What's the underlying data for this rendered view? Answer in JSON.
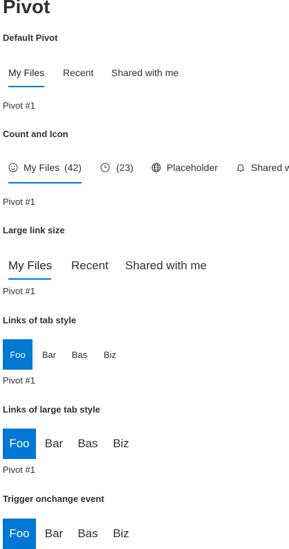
{
  "page_title": "Pivot",
  "sections": {
    "default": {
      "title": "Default Pivot",
      "links": [
        "My Files",
        "Recent",
        "Shared with me"
      ],
      "content": "Pivot #1"
    },
    "count_icon": {
      "title": "Count and Icon",
      "links": [
        {
          "label": "My Files",
          "count": "(42)",
          "icon": "smiley-icon"
        },
        {
          "label": "",
          "count": "(23)",
          "icon": "clock-icon"
        },
        {
          "label": "Placeholder",
          "count": "",
          "icon": "globe-icon"
        },
        {
          "label": "Shared with me",
          "count": "",
          "icon": "bell-icon"
        }
      ],
      "content": "Pivot #1"
    },
    "large_link": {
      "title": "Large link size",
      "links": [
        "My Files",
        "Recent",
        "Shared with me"
      ],
      "content": "Pivot #1"
    },
    "tab_style": {
      "title": "Links of tab style",
      "links": [
        "Foo",
        "Bar",
        "Bas",
        "Biz"
      ],
      "content": "Pivot #1"
    },
    "large_tab_style": {
      "title": "Links of large tab style",
      "links": [
        "Foo",
        "Bar",
        "Bas",
        "Biz"
      ],
      "content": "Pivot #1"
    },
    "onchange": {
      "title": "Trigger onchange event",
      "links": [
        "Foo",
        "Bar",
        "Bas",
        "Biz"
      ]
    }
  },
  "colors": {
    "accent": "#0078d4",
    "text": "#323130",
    "selected_text": "#ffffff"
  }
}
